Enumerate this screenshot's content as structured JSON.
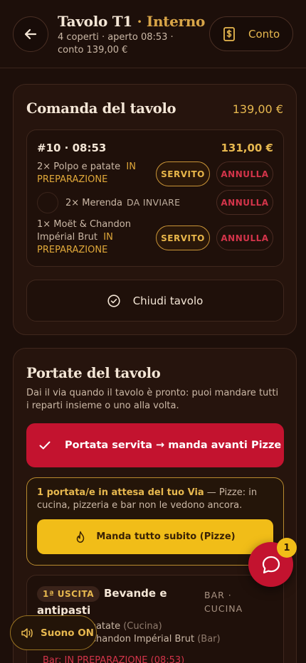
{
  "header": {
    "title": "Tavolo T1",
    "title_accent": "· Interno",
    "subtitle": "4 coperti · aperto 08:53 · conto 139,00 €",
    "conto_label": "Conto"
  },
  "comanda": {
    "title": "Comanda del tavolo",
    "total": "139,00 €",
    "order": {
      "id": "#10 · 08:53",
      "amount": "131,00 €",
      "items": [
        {
          "text": "2× Polpo e patate",
          "status": "IN PREPARAZIONE",
          "served_label": "SERVITO",
          "cancel_label": "ANNULLA"
        },
        {
          "text": "2× Merenda",
          "status": "DA INVIARE",
          "cancel_label": "ANNULLA"
        },
        {
          "text": "1× Moët & Chandon Impérial Brut",
          "status": "IN PREPARAZIONE",
          "served_label": "SERVITO",
          "cancel_label": "ANNULLA"
        }
      ]
    },
    "close_label": "Chiudi tavolo"
  },
  "portate": {
    "title": "Portate del tavolo",
    "description": "Dai il via quando il tavolo è pronto: puoi mandare tutti i reparti insieme o uno alla volta.",
    "served_button": "Portata servita → manda avanti Pizze",
    "note_strong": "1 portata/e in attesa del tuo Via",
    "note_rest": " — Pizze: in cucina, pizzeria e bar non le vedono ancora.",
    "send_all_label": "Manda tutto subito (Pizze)",
    "course": {
      "badge": "1ª USCITA",
      "name": "Bevande e antipasti",
      "departments": "BAR · CUCINA",
      "line1_main": "2× Polpo e patate",
      "line1_dept": "(Cucina)",
      "line2_main": "1× Moët & Chandon Impérial Brut",
      "line2_dept": "(Bar)",
      "status": "Bar: IN PREPARAZIONE (08:53)"
    }
  },
  "floating": {
    "sound_label": "Suono ON",
    "chat_badge": "1"
  },
  "colors": {
    "background": "#1d0f0a",
    "accent_gold": "#e7b84f",
    "accent_red": "#c3132f",
    "yellow": "#f1bd18"
  }
}
